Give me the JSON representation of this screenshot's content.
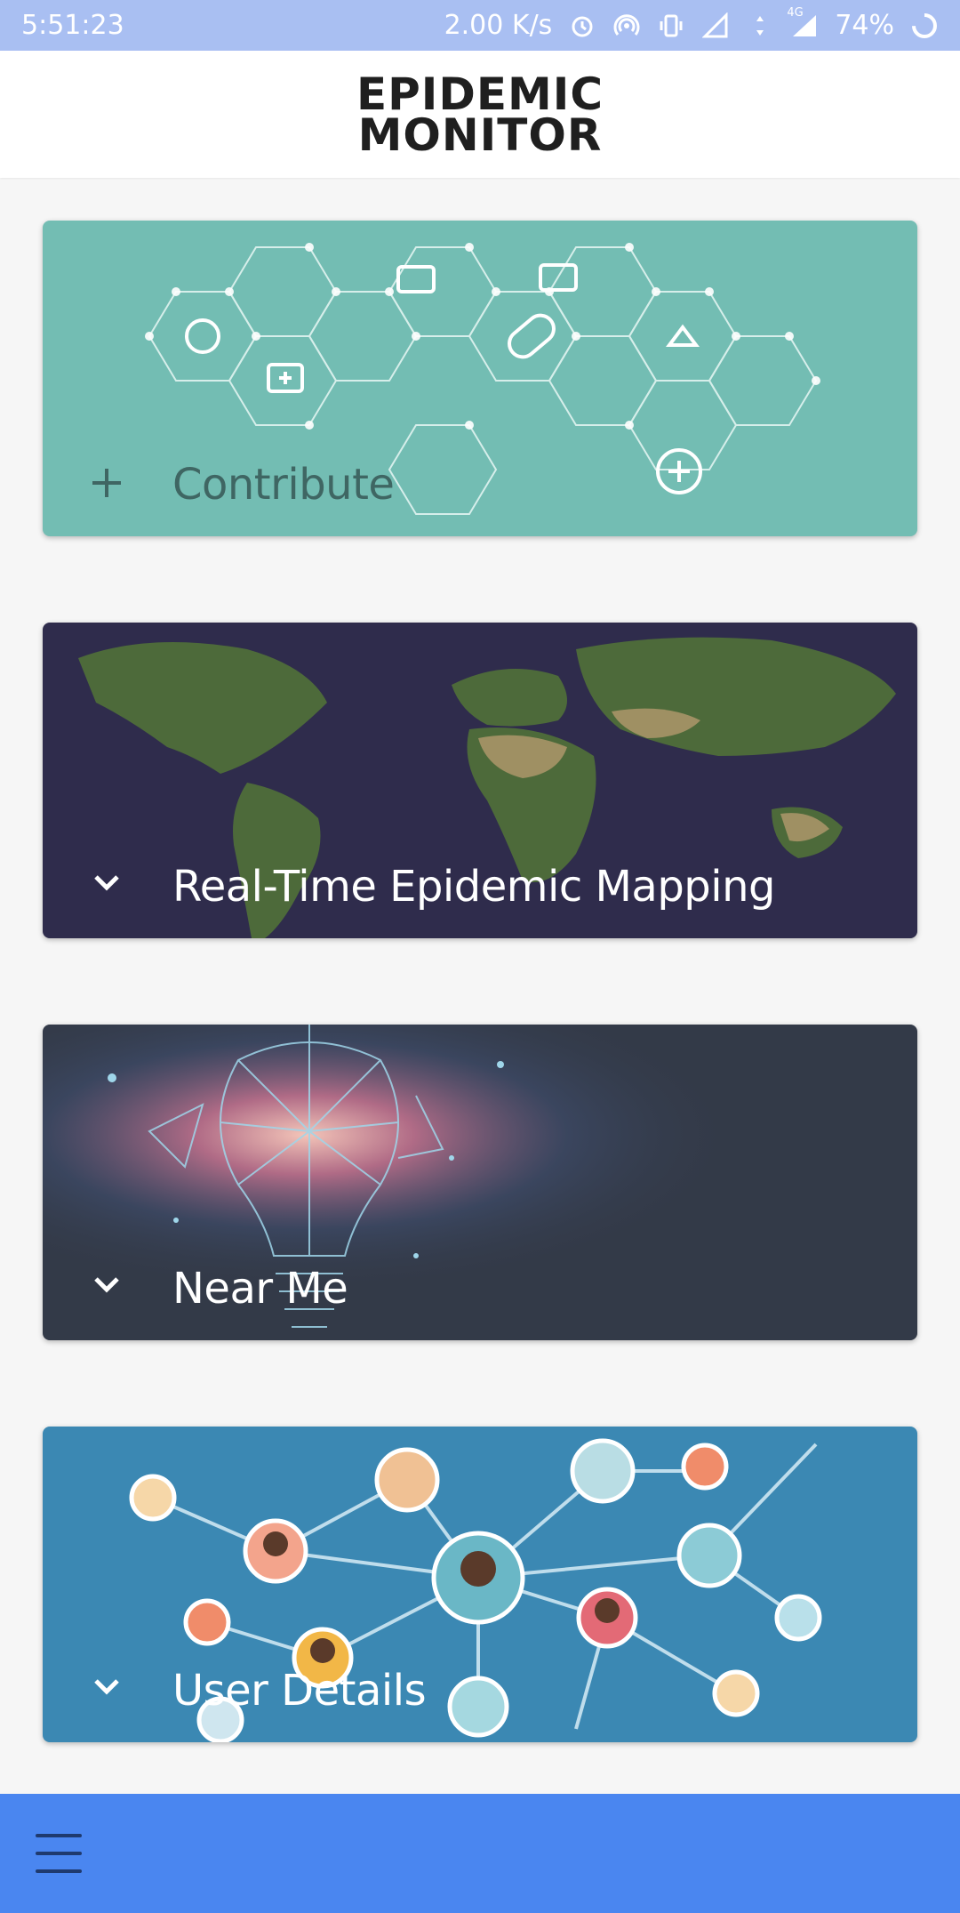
{
  "status_bar": {
    "time": "5:51:23",
    "network_speed": "2.00 K/s",
    "network_type": "4G",
    "battery": "74%",
    "icons": [
      "alarm-icon",
      "hotspot-icon",
      "vibrate-icon",
      "signal-icon",
      "data-arrows-icon",
      "signal-4g-icon",
      "battery-icon"
    ]
  },
  "app": {
    "logo_line1": "EPIDEMIC",
    "logo_line2": "MONITOR"
  },
  "cards": [
    {
      "id": "contribute",
      "label": "Contribute",
      "icon": "plus-icon"
    },
    {
      "id": "mapping",
      "label": "Real-Time Epidemic Mapping",
      "icon": "chevron-down-icon"
    },
    {
      "id": "nearme",
      "label": "Near Me",
      "icon": "chevron-down-icon"
    },
    {
      "id": "user",
      "label": "User Details",
      "icon": "chevron-down-icon"
    }
  ],
  "bottom_bar": {
    "icon": "menu-icon"
  },
  "colors": {
    "status_bar": "#a9bff2",
    "bottom_bar": "#4a86f0",
    "contribute_card": "#73bdb3",
    "mapping_card": "#2f2c4c",
    "nearme_card": "#333a48",
    "user_card": "#3b88b3"
  }
}
